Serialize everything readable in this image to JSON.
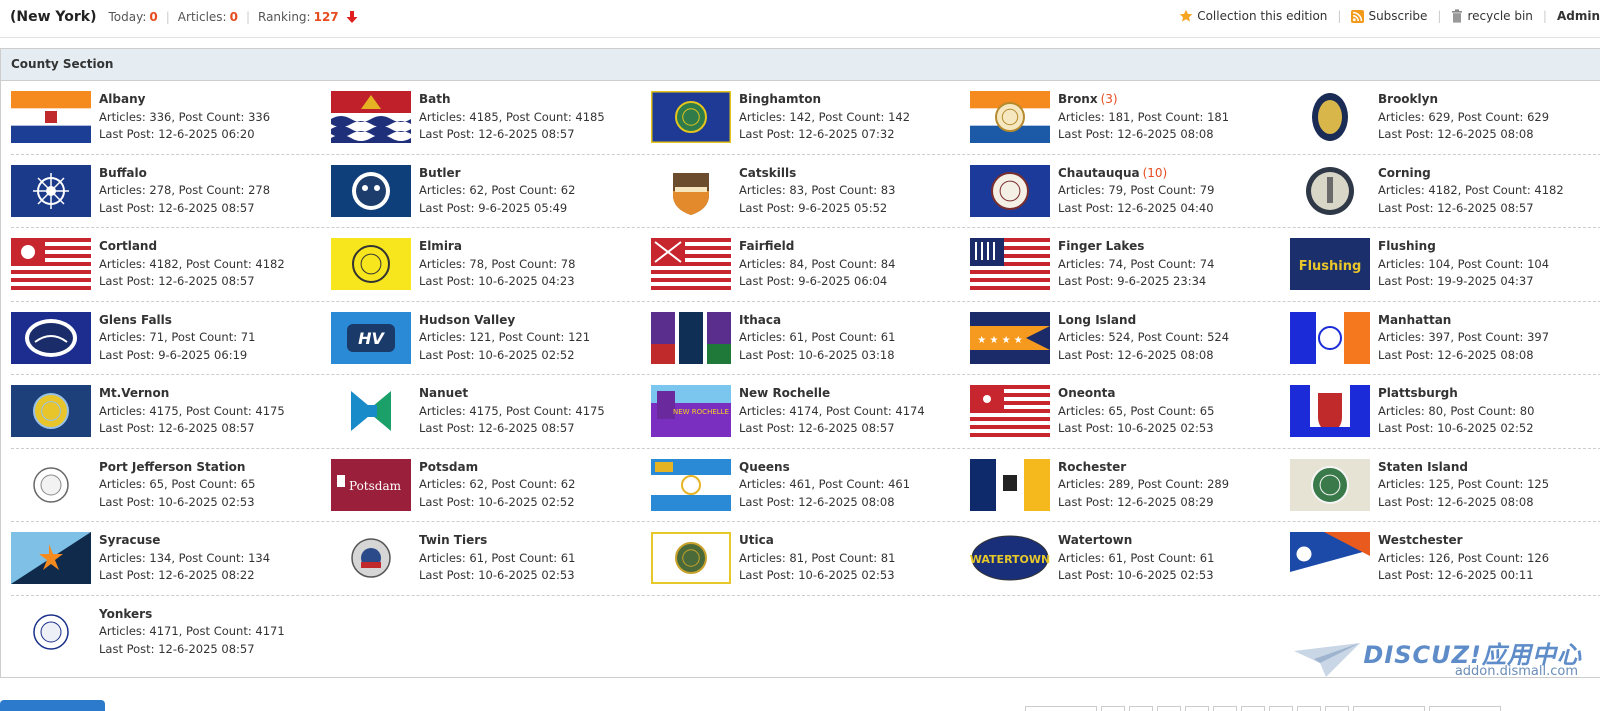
{
  "header": {
    "forum_name": "(New York)",
    "today_label": "Today:",
    "today_value": "0",
    "articles_label": "Articles:",
    "articles_value": "0",
    "ranking_label": "Ranking:",
    "ranking_value": "127",
    "links": [
      {
        "label": "Collection this edition",
        "icon": "star-icon"
      },
      {
        "label": "Subscribe",
        "icon": "rss-icon"
      },
      {
        "label": "recycle bin",
        "icon": "trash-icon"
      },
      {
        "label": "Admin"
      }
    ]
  },
  "section": {
    "title": "County Section"
  },
  "forums": [
    {
      "name": "Albany",
      "today": "",
      "stats": "Articles: 336, Post Count: 336",
      "last": "Last Post: 12-6-2025 06:20",
      "flag": "albany"
    },
    {
      "name": "Bath",
      "today": "",
      "stats": "Articles: 4185, Post Count: 4185",
      "last": "Last Post: 12-6-2025 08:57",
      "flag": "bath"
    },
    {
      "name": "Binghamton",
      "today": "",
      "stats": "Articles: 142, Post Count: 142",
      "last": "Last Post: 12-6-2025 07:32",
      "flag": "binghamton"
    },
    {
      "name": "Bronx",
      "today": "(3)",
      "stats": "Articles: 181, Post Count: 181",
      "last": "Last Post: 12-6-2025 08:08",
      "flag": "bronx"
    },
    {
      "name": "Brooklyn",
      "today": "",
      "stats": "Articles: 629, Post Count: 629",
      "last": "Last Post: 12-6-2025 08:08",
      "flag": "brooklyn"
    },
    {
      "name": "Buffalo",
      "today": "",
      "stats": "Articles: 278, Post Count: 278",
      "last": "Last Post: 12-6-2025 08:57",
      "flag": "buffalo"
    },
    {
      "name": "Butler",
      "today": "",
      "stats": "Articles: 62, Post Count: 62",
      "last": "Last Post: 9-6-2025 05:49",
      "flag": "butler"
    },
    {
      "name": "Catskills",
      "today": "",
      "stats": "Articles: 83, Post Count: 83",
      "last": "Last Post: 9-6-2025 05:52",
      "flag": "catskills"
    },
    {
      "name": "Chautauqua",
      "today": "(10)",
      "stats": "Articles: 79, Post Count: 79",
      "last": "Last Post: 12-6-2025 04:40",
      "flag": "chautauqua"
    },
    {
      "name": "Corning",
      "today": "",
      "stats": "Articles: 4182, Post Count: 4182",
      "last": "Last Post: 12-6-2025 08:57",
      "flag": "corning"
    },
    {
      "name": "Cortland",
      "today": "",
      "stats": "Articles: 4182, Post Count: 4182",
      "last": "Last Post: 12-6-2025 08:57",
      "flag": "cortland"
    },
    {
      "name": "Elmira",
      "today": "",
      "stats": "Articles: 78, Post Count: 78",
      "last": "Last Post: 10-6-2025 04:23",
      "flag": "elmira"
    },
    {
      "name": "Fairfield",
      "today": "",
      "stats": "Articles: 84, Post Count: 84",
      "last": "Last Post: 9-6-2025 06:04",
      "flag": "fairfield"
    },
    {
      "name": "Finger Lakes",
      "today": "",
      "stats": "Articles: 74, Post Count: 74",
      "last": "Last Post: 9-6-2025 23:34",
      "flag": "fingerlakes"
    },
    {
      "name": "Flushing",
      "today": "",
      "stats": "Articles: 104, Post Count: 104",
      "last": "Last Post: 19-9-2025 04:37",
      "flag": "flushing"
    },
    {
      "name": "Glens Falls",
      "today": "",
      "stats": "Articles: 71, Post Count: 71",
      "last": "Last Post: 9-6-2025 06:19",
      "flag": "glensfalls"
    },
    {
      "name": "Hudson Valley",
      "today": "",
      "stats": "Articles: 121, Post Count: 121",
      "last": "Last Post: 10-6-2025 02:52",
      "flag": "hudsonvalley"
    },
    {
      "name": "Ithaca",
      "today": "",
      "stats": "Articles: 61, Post Count: 61",
      "last": "Last Post: 10-6-2025 03:18",
      "flag": "ithaca"
    },
    {
      "name": "Long Island",
      "today": "",
      "stats": "Articles: 524, Post Count: 524",
      "last": "Last Post: 12-6-2025 08:08",
      "flag": "longisland"
    },
    {
      "name": "Manhattan",
      "today": "",
      "stats": "Articles: 397, Post Count: 397",
      "last": "Last Post: 12-6-2025 08:08",
      "flag": "manhattan"
    },
    {
      "name": "Mt.Vernon",
      "today": "",
      "stats": "Articles: 4175, Post Count: 4175",
      "last": "Last Post: 12-6-2025 08:57",
      "flag": "mtvernon"
    },
    {
      "name": "Nanuet",
      "today": "",
      "stats": "Articles: 4175, Post Count: 4175",
      "last": "Last Post: 12-6-2025 08:57",
      "flag": "nanuet"
    },
    {
      "name": "New Rochelle",
      "today": "",
      "stats": "Articles: 4174, Post Count: 4174",
      "last": "Last Post: 12-6-2025 08:57",
      "flag": "newrochelle"
    },
    {
      "name": "Oneonta",
      "today": "",
      "stats": "Articles: 65, Post Count: 65",
      "last": "Last Post: 10-6-2025 02:53",
      "flag": "oneonta"
    },
    {
      "name": "Plattsburgh",
      "today": "",
      "stats": "Articles: 80, Post Count: 80",
      "last": "Last Post: 10-6-2025 02:52",
      "flag": "plattsburgh"
    },
    {
      "name": "Port Jefferson Station",
      "today": "",
      "stats": "Articles: 65, Post Count: 65",
      "last": "Last Post: 10-6-2025 02:53",
      "flag": "portjefferson"
    },
    {
      "name": "Potsdam",
      "today": "",
      "stats": "Articles: 62, Post Count: 62",
      "last": "Last Post: 10-6-2025 02:52",
      "flag": "potsdam"
    },
    {
      "name": "Queens",
      "today": "",
      "stats": "Articles: 461, Post Count: 461",
      "last": "Last Post: 12-6-2025 08:08",
      "flag": "queens"
    },
    {
      "name": "Rochester",
      "today": "",
      "stats": "Articles: 289, Post Count: 289",
      "last": "Last Post: 12-6-2025 08:29",
      "flag": "rochester"
    },
    {
      "name": "Staten Island",
      "today": "",
      "stats": "Articles: 125, Post Count: 125",
      "last": "Last Post: 12-6-2025 08:08",
      "flag": "statenisland"
    },
    {
      "name": "Syracuse",
      "today": "",
      "stats": "Articles: 134, Post Count: 134",
      "last": "Last Post: 12-6-2025 08:22",
      "flag": "syracuse"
    },
    {
      "name": "Twin Tiers",
      "today": "",
      "stats": "Articles: 61, Post Count: 61",
      "last": "Last Post: 10-6-2025 02:53",
      "flag": "twintiers"
    },
    {
      "name": "Utica",
      "today": "",
      "stats": "Articles: 81, Post Count: 81",
      "last": "Last Post: 10-6-2025 02:53",
      "flag": "utica"
    },
    {
      "name": "Watertown",
      "today": "",
      "stats": "Articles: 61, Post Count: 61",
      "last": "Last Post: 10-6-2025 02:53",
      "flag": "watertown"
    },
    {
      "name": "Westchester",
      "today": "",
      "stats": "Articles: 126, Post Count: 126",
      "last": "Last Post: 12-6-2025 00:11",
      "flag": "westchester"
    },
    {
      "name": "Yonkers",
      "today": "",
      "stats": "Articles: 4171, Post Count: 4171",
      "last": "Last Post: 12-6-2025 08:57",
      "flag": "yonkers"
    }
  ],
  "watermark": {
    "brand": "DISCUZ!应用中心",
    "url": "addon.dismall.com"
  },
  "colors": {
    "accent": "#e64c1e",
    "section_head_bg": "#e5edf2",
    "border": "#cdcdcd"
  }
}
